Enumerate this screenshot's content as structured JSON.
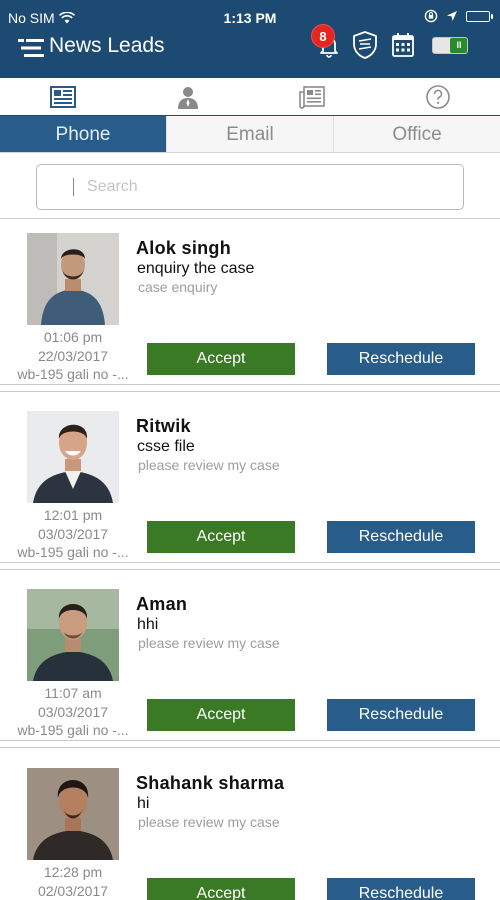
{
  "status_bar": {
    "carrier": "No SIM",
    "time": "1:13 PM"
  },
  "header": {
    "title": "News Leads",
    "notification_count": "8"
  },
  "icon_tabs": [
    {
      "icon": "newspaper-icon"
    },
    {
      "icon": "person-icon"
    },
    {
      "icon": "documents-icon"
    },
    {
      "icon": "help-icon"
    }
  ],
  "channel_tabs": {
    "phone": "Phone",
    "email": "Email",
    "office": "Office",
    "active": "Phone"
  },
  "search": {
    "placeholder": "Search"
  },
  "leads": [
    {
      "name": "Alok singh",
      "subject": "enquiry the case",
      "description": "case enquiry",
      "time": "01:06 pm",
      "date": "22/03/2017",
      "address": "wb-195 gali no -...",
      "accept_label": "Accept",
      "reschedule_label": "Reschedule"
    },
    {
      "name": "Ritwik",
      "subject": "csse file",
      "description": "please review my case",
      "time": "12:01 pm",
      "date": "03/03/2017",
      "address": "wb-195 gali no -...",
      "accept_label": "Accept",
      "reschedule_label": "Reschedule"
    },
    {
      "name": "Aman",
      "subject": "hhi",
      "description": "please review my case",
      "time": "11:07 am",
      "date": "03/03/2017",
      "address": "wb-195 gali no -...",
      "accept_label": "Accept",
      "reschedule_label": "Reschedule"
    },
    {
      "name": "Shahank sharma",
      "subject": "hi",
      "description": "please review my case",
      "time": "12:28 pm",
      "date": "02/03/2017",
      "address": "",
      "accept_label": "Accept",
      "reschedule_label": "Reschedule"
    }
  ],
  "colors": {
    "header": "#1d4a73",
    "accept": "#3a7a24",
    "reschedule": "#285c8a",
    "badge": "#e3261f"
  }
}
